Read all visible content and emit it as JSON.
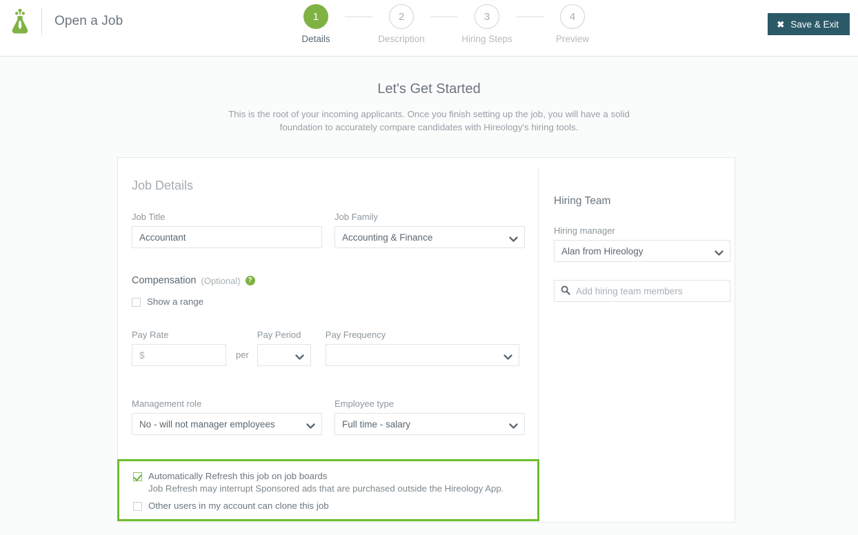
{
  "header": {
    "logo_icon": "flask-icon",
    "app_title": "Open a Job",
    "save_exit": {
      "label": "Save & Exit",
      "icon": "close-x-icon"
    },
    "accent_green": "#7fb243",
    "button_color": "#2c5968"
  },
  "stepper": {
    "steps": [
      {
        "number": "1",
        "label": "Details",
        "active": true
      },
      {
        "number": "2",
        "label": "Description",
        "active": false
      },
      {
        "number": "3",
        "label": "Hiring Steps",
        "active": false
      },
      {
        "number": "4",
        "label": "Preview",
        "active": false
      }
    ]
  },
  "intro": {
    "heading": "Let's Get Started",
    "subtitle": "This is the root of your incoming applicants. Once you finish setting up the job, you will have a solid foundation to accurately compare candidates with Hireology's hiring tools."
  },
  "job_details": {
    "section_title": "Job Details",
    "job_title": {
      "label": "Job Title",
      "value": "Accountant",
      "placeholder": ""
    },
    "job_family": {
      "label": "Job Family",
      "value": "Accounting & Finance",
      "chevron": "chevron-down-icon"
    },
    "compensation": {
      "label": "Compensation",
      "optional_note": "(Optional)",
      "help_icon": "question-mark-icon",
      "help_icon_color": "#7fb243",
      "show_range": {
        "label": "Show a range",
        "checked": false
      }
    },
    "pay_rate": {
      "label": "Pay Rate",
      "value": "",
      "placeholder": "$"
    },
    "per_label": "per",
    "pay_period": {
      "label": "Pay Period",
      "value": "",
      "chevron": "chevron-down-icon"
    },
    "pay_frequency": {
      "label": "Pay Frequency",
      "value": "",
      "chevron": "chevron-down-icon"
    },
    "management_role": {
      "label": "Management role",
      "value": "No - will not manager employees",
      "chevron": "chevron-down-icon"
    },
    "employee_type": {
      "label": "Employee type",
      "value": "Full time - salary",
      "chevron": "chevron-down-icon"
    }
  },
  "highlight_box": {
    "border_color": "#6cbe2d",
    "auto_refresh": {
      "label": "Automatically Refresh this job on job boards",
      "checked": true
    },
    "auto_refresh_note": "Job Refresh may interrupt Sponsored ads that are purchased outside the Hireology App.",
    "clone_job": {
      "label": "Other users in my account can clone this job",
      "checked": false
    }
  },
  "hiring_team": {
    "section_title": "Hiring Team",
    "hiring_manager": {
      "label": "Hiring manager",
      "value": "Alan from Hireology",
      "chevron": "chevron-down-icon"
    },
    "add_members": {
      "placeholder": "Add hiring team members",
      "value": "",
      "icon": "search-icon"
    }
  }
}
